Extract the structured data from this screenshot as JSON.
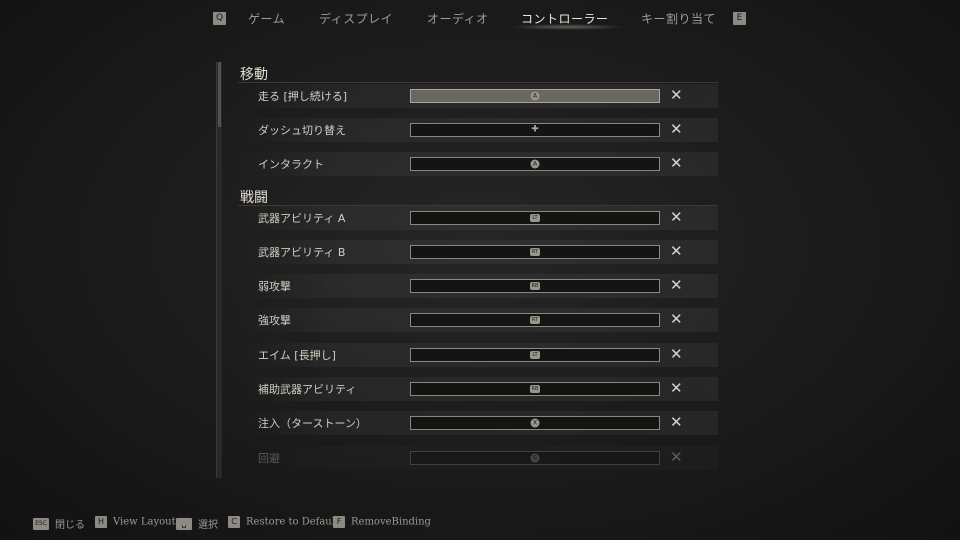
{
  "tabs": {
    "prev_key": "Q",
    "next_key": "E",
    "items": [
      "ゲーム",
      "ディスプレイ",
      "オーディオ",
      "コントローラー",
      "キー割り当て"
    ],
    "active": "コントローラー"
  },
  "sections": [
    {
      "title": "移動",
      "rows": [
        {
          "label": "走る [押し続ける]",
          "glyph": "A",
          "selected": true
        },
        {
          "label": "ダッシュ切り替え",
          "glyph": "✚",
          "selected": false
        },
        {
          "label": "インタラクト",
          "glyph": "A",
          "selected": false
        }
      ]
    },
    {
      "title": "戦闘",
      "rows": [
        {
          "label": "武器アビリティ A",
          "glyph": "LT",
          "selected": false
        },
        {
          "label": "武器アビリティ B",
          "glyph": "RT",
          "selected": false
        },
        {
          "label": "弱攻撃",
          "glyph": "RB",
          "selected": false
        },
        {
          "label": "強攻撃",
          "glyph": "RT",
          "selected": false
        },
        {
          "label": "エイム [長押し]",
          "glyph": "LT",
          "selected": false
        },
        {
          "label": "補助武器アビリティ",
          "glyph": "RB",
          "selected": false
        },
        {
          "label": "注入（ターストーン）",
          "glyph": "X",
          "selected": false
        },
        {
          "label": "回避",
          "glyph": "B",
          "selected": false
        }
      ]
    }
  ],
  "remove_symbol": "✕",
  "footer": [
    {
      "key": "ESC",
      "label": "閉じる"
    },
    {
      "key": "H",
      "label": "View Layout"
    },
    {
      "key": "␣",
      "label": "選択"
    },
    {
      "key": "C",
      "label": "Restore to Default"
    },
    {
      "key": "F",
      "label": "RemoveBinding"
    }
  ]
}
